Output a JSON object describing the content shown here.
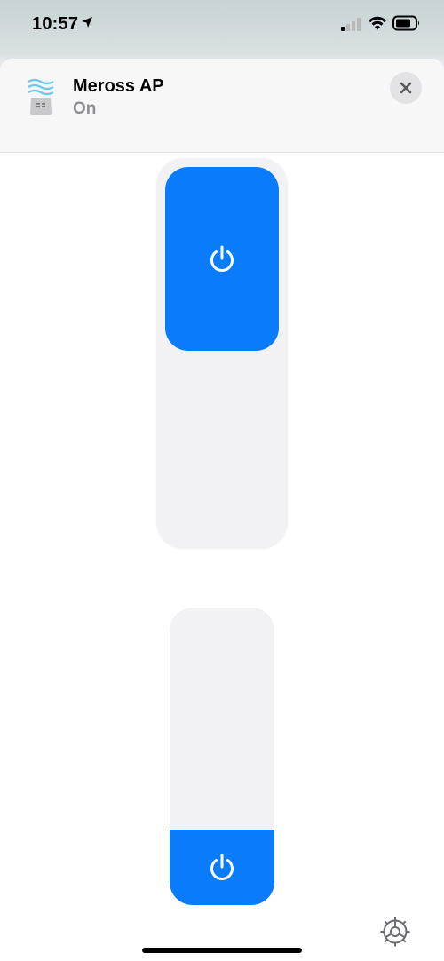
{
  "status_bar": {
    "time": "10:57",
    "icons": [
      "location-arrow-icon",
      "cellular-signal-icon",
      "wifi-icon",
      "battery-icon"
    ]
  },
  "header": {
    "device_name": "Meross AP",
    "device_state": "On",
    "icon": "air-purifier-icon",
    "close_icon": "close-icon"
  },
  "controls": {
    "main_power_toggle": {
      "icon": "power-icon",
      "state": "on",
      "level": 0.47
    },
    "secondary_power_toggle": {
      "icon": "power-icon",
      "state": "on",
      "level": 0.25
    }
  },
  "footer": {
    "settings_icon": "gear-icon"
  },
  "colors": {
    "accent": "#0a7bfa",
    "tile_background": "#f2f2f4",
    "secondary_text": "#8e8e93",
    "header_background": "#f7f7f7"
  }
}
